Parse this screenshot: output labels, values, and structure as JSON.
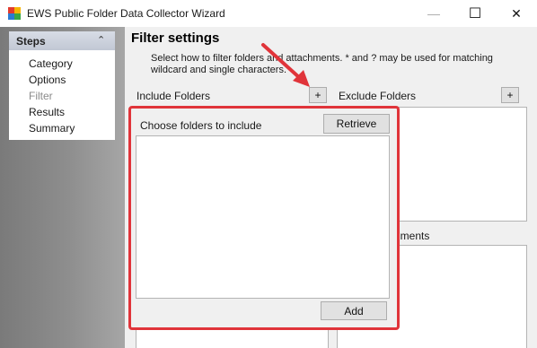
{
  "window": {
    "title": "EWS Public Folder Data Collector Wizard",
    "minimize_glyph": "—",
    "maximize_glyph": "☐",
    "close_glyph": "✕"
  },
  "steps": {
    "title": "Steps",
    "collapse_glyph": "⌃",
    "items": [
      {
        "label": "Category",
        "active": false
      },
      {
        "label": "Options",
        "active": false
      },
      {
        "label": "Filter",
        "active": true
      },
      {
        "label": "Results",
        "active": false
      },
      {
        "label": "Summary",
        "active": false
      }
    ]
  },
  "main": {
    "heading": "Filter settings",
    "description": "Select how to filter folders and attachments. * and ? may be used for matching wildcard and single characters."
  },
  "include": {
    "label": "Include Folders",
    "add_glyph": "+",
    "choose_label": "Choose folders to include",
    "retrieve_label": "Retrieve",
    "add_label": "Add"
  },
  "exclude": {
    "label": "Exclude Folders",
    "add_glyph": "+"
  },
  "attachments": {
    "label_fragment": "hments"
  },
  "colors": {
    "highlight": "#e0343a",
    "arrow": "#e0343a"
  }
}
